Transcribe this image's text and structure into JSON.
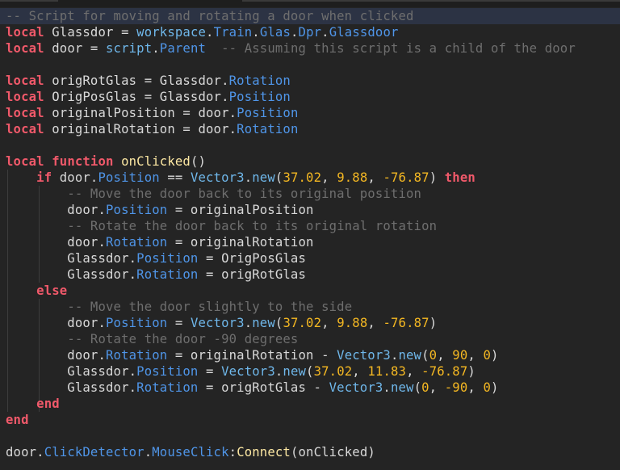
{
  "editor": {
    "language": "lua",
    "highlighted_line": 0,
    "lines": [
      [
        {
          "t": "cm",
          "v": "-- Script for moving and rotating a door when clicked"
        }
      ],
      [
        {
          "t": "kw",
          "v": "local"
        },
        {
          "t": "tx",
          "v": " Glassdor = "
        },
        {
          "t": "gl",
          "v": "workspace"
        },
        {
          "t": "tx",
          "v": "."
        },
        {
          "t": "pr",
          "v": "Train"
        },
        {
          "t": "tx",
          "v": "."
        },
        {
          "t": "pr",
          "v": "Glas"
        },
        {
          "t": "tx",
          "v": "."
        },
        {
          "t": "pr",
          "v": "Dpr"
        },
        {
          "t": "tx",
          "v": "."
        },
        {
          "t": "pr",
          "v": "Glassdoor"
        }
      ],
      [
        {
          "t": "kw",
          "v": "local"
        },
        {
          "t": "tx",
          "v": " door = "
        },
        {
          "t": "gl",
          "v": "script"
        },
        {
          "t": "tx",
          "v": "."
        },
        {
          "t": "pr",
          "v": "Parent"
        },
        {
          "t": "tx",
          "v": "  "
        },
        {
          "t": "cm",
          "v": "-- Assuming this script is a child of the door"
        }
      ],
      [],
      [
        {
          "t": "kw",
          "v": "local"
        },
        {
          "t": "tx",
          "v": " origRotGlas = Glassdor."
        },
        {
          "t": "pr",
          "v": "Rotation"
        }
      ],
      [
        {
          "t": "kw",
          "v": "local"
        },
        {
          "t": "tx",
          "v": " OrigPosGlas = Glassdor."
        },
        {
          "t": "pr",
          "v": "Position"
        }
      ],
      [
        {
          "t": "kw",
          "v": "local"
        },
        {
          "t": "tx",
          "v": " originalPosition = door."
        },
        {
          "t": "pr",
          "v": "Position"
        }
      ],
      [
        {
          "t": "kw",
          "v": "local"
        },
        {
          "t": "tx",
          "v": " originalRotation = door."
        },
        {
          "t": "pr",
          "v": "Rotation"
        }
      ],
      [],
      [
        {
          "t": "kw",
          "v": "local"
        },
        {
          "t": "tx",
          "v": " "
        },
        {
          "t": "kw",
          "v": "function"
        },
        {
          "t": "tx",
          "v": " "
        },
        {
          "t": "fn",
          "v": "onClicked"
        },
        {
          "t": "tx",
          "v": "()"
        }
      ],
      [
        {
          "t": "tx",
          "v": "    "
        },
        {
          "t": "kw",
          "v": "if"
        },
        {
          "t": "tx",
          "v": " door."
        },
        {
          "t": "pr",
          "v": "Position"
        },
        {
          "t": "tx",
          "v": " == "
        },
        {
          "t": "gl",
          "v": "Vector3"
        },
        {
          "t": "tx",
          "v": "."
        },
        {
          "t": "gl",
          "v": "new"
        },
        {
          "t": "tx",
          "v": "("
        },
        {
          "t": "nm",
          "v": "37.02"
        },
        {
          "t": "tx",
          "v": ", "
        },
        {
          "t": "nm",
          "v": "9.88"
        },
        {
          "t": "tx",
          "v": ", "
        },
        {
          "t": "nm",
          "v": "-76.87"
        },
        {
          "t": "tx",
          "v": ") "
        },
        {
          "t": "kw",
          "v": "then"
        }
      ],
      [
        {
          "t": "tx",
          "v": "        "
        },
        {
          "t": "cm",
          "v": "-- Move the door back to its original position"
        }
      ],
      [
        {
          "t": "tx",
          "v": "        door."
        },
        {
          "t": "pr",
          "v": "Position"
        },
        {
          "t": "tx",
          "v": " = originalPosition"
        }
      ],
      [
        {
          "t": "tx",
          "v": "        "
        },
        {
          "t": "cm",
          "v": "-- Rotate the door back to its original rotation"
        }
      ],
      [
        {
          "t": "tx",
          "v": "        door."
        },
        {
          "t": "pr",
          "v": "Rotation"
        },
        {
          "t": "tx",
          "v": " = originalRotation"
        }
      ],
      [
        {
          "t": "tx",
          "v": "        Glassdor."
        },
        {
          "t": "pr",
          "v": "Position"
        },
        {
          "t": "tx",
          "v": " = OrigPosGlas"
        }
      ],
      [
        {
          "t": "tx",
          "v": "        Glassdor."
        },
        {
          "t": "pr",
          "v": "Rotation"
        },
        {
          "t": "tx",
          "v": " = origRotGlas"
        }
      ],
      [
        {
          "t": "tx",
          "v": "    "
        },
        {
          "t": "kw",
          "v": "else"
        }
      ],
      [
        {
          "t": "tx",
          "v": "        "
        },
        {
          "t": "cm",
          "v": "-- Move the door slightly to the side"
        }
      ],
      [
        {
          "t": "tx",
          "v": "        door."
        },
        {
          "t": "pr",
          "v": "Position"
        },
        {
          "t": "tx",
          "v": " = "
        },
        {
          "t": "gl",
          "v": "Vector3"
        },
        {
          "t": "tx",
          "v": "."
        },
        {
          "t": "gl",
          "v": "new"
        },
        {
          "t": "tx",
          "v": "("
        },
        {
          "t": "nm",
          "v": "37.02"
        },
        {
          "t": "tx",
          "v": ", "
        },
        {
          "t": "nm",
          "v": "9.88"
        },
        {
          "t": "tx",
          "v": ", "
        },
        {
          "t": "nm",
          "v": "-76.87"
        },
        {
          "t": "tx",
          "v": ")"
        }
      ],
      [
        {
          "t": "tx",
          "v": "        "
        },
        {
          "t": "cm",
          "v": "-- Rotate the door -90 degrees"
        }
      ],
      [
        {
          "t": "tx",
          "v": "        door."
        },
        {
          "t": "pr",
          "v": "Rotation"
        },
        {
          "t": "tx",
          "v": " = originalRotation - "
        },
        {
          "t": "gl",
          "v": "Vector3"
        },
        {
          "t": "tx",
          "v": "."
        },
        {
          "t": "gl",
          "v": "new"
        },
        {
          "t": "tx",
          "v": "("
        },
        {
          "t": "nm",
          "v": "0"
        },
        {
          "t": "tx",
          "v": ", "
        },
        {
          "t": "nm",
          "v": "90"
        },
        {
          "t": "tx",
          "v": ", "
        },
        {
          "t": "nm",
          "v": "0"
        },
        {
          "t": "tx",
          "v": ")"
        }
      ],
      [
        {
          "t": "tx",
          "v": "        Glassdor."
        },
        {
          "t": "pr",
          "v": "Position"
        },
        {
          "t": "tx",
          "v": " = "
        },
        {
          "t": "gl",
          "v": "Vector3"
        },
        {
          "t": "tx",
          "v": "."
        },
        {
          "t": "gl",
          "v": "new"
        },
        {
          "t": "tx",
          "v": "("
        },
        {
          "t": "nm",
          "v": "37.02"
        },
        {
          "t": "tx",
          "v": ", "
        },
        {
          "t": "nm",
          "v": "11.83"
        },
        {
          "t": "tx",
          "v": ", "
        },
        {
          "t": "nm",
          "v": "-76.87"
        },
        {
          "t": "tx",
          "v": ")"
        }
      ],
      [
        {
          "t": "tx",
          "v": "        Glassdor."
        },
        {
          "t": "pr",
          "v": "Rotation"
        },
        {
          "t": "tx",
          "v": " = origRotGlas - "
        },
        {
          "t": "gl",
          "v": "Vector3"
        },
        {
          "t": "tx",
          "v": "."
        },
        {
          "t": "gl",
          "v": "new"
        },
        {
          "t": "tx",
          "v": "("
        },
        {
          "t": "nm",
          "v": "0"
        },
        {
          "t": "tx",
          "v": ", "
        },
        {
          "t": "nm",
          "v": "-90"
        },
        {
          "t": "tx",
          "v": ", "
        },
        {
          "t": "nm",
          "v": "0"
        },
        {
          "t": "tx",
          "v": ")"
        }
      ],
      [
        {
          "t": "tx",
          "v": "    "
        },
        {
          "t": "kw",
          "v": "end"
        }
      ],
      [
        {
          "t": "kw",
          "v": "end"
        }
      ],
      [],
      [
        {
          "t": "tx",
          "v": "door."
        },
        {
          "t": "pr",
          "v": "ClickDetector"
        },
        {
          "t": "tx",
          "v": "."
        },
        {
          "t": "pr",
          "v": "MouseClick"
        },
        {
          "t": "tx",
          "v": ":"
        },
        {
          "t": "fn",
          "v": "Connect"
        },
        {
          "t": "tx",
          "v": "(onClicked)"
        }
      ]
    ]
  },
  "colors": {
    "background": "#242424",
    "keyword": "#f0596a",
    "comment": "#6e6e6e",
    "property": "#4f95e8",
    "global": "#6fb7ea",
    "function": "#fde8a3",
    "number": "#f5b822",
    "text": "#d9d9d9",
    "highlight": "#2c3344"
  }
}
